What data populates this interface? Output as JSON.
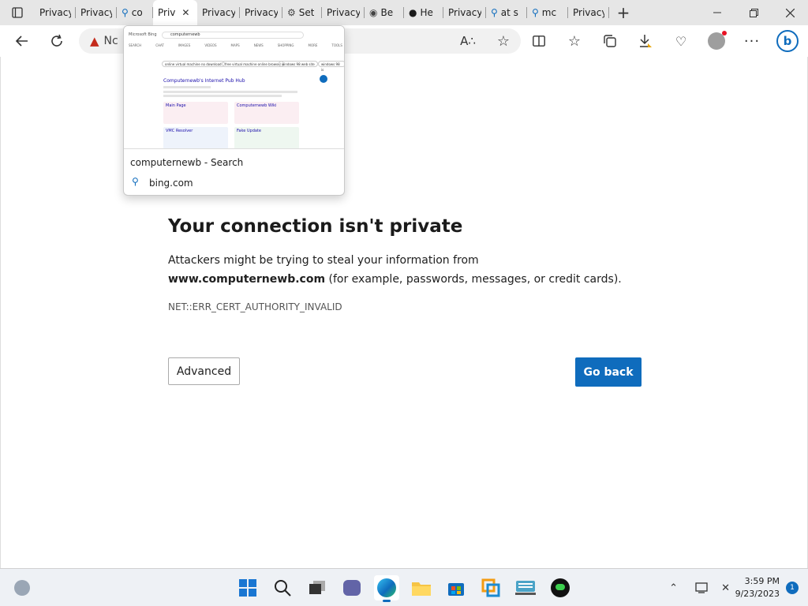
{
  "tabs": [
    {
      "label": "Privacy e",
      "icon": "doc-icon",
      "active": false
    },
    {
      "label": "Privacy e",
      "icon": "doc-icon",
      "active": false
    },
    {
      "label": "co",
      "icon": "search-icon",
      "active": false
    },
    {
      "label": "Priv",
      "icon": "doc-icon",
      "active": true
    },
    {
      "label": "Privacy e",
      "icon": "doc-icon",
      "active": false
    },
    {
      "label": "Privacy e",
      "icon": "doc-icon",
      "active": false
    },
    {
      "label": "Set",
      "icon": "gear-icon",
      "active": false
    },
    {
      "label": "Privacy e",
      "icon": "doc-icon",
      "active": false
    },
    {
      "label": "Be",
      "icon": "chrome-icon",
      "active": false
    },
    {
      "label": "He",
      "icon": "opera-icon",
      "active": false
    },
    {
      "label": "Privacy e",
      "icon": "doc-icon",
      "active": false
    },
    {
      "label": "at s",
      "icon": "search-icon",
      "active": false
    },
    {
      "label": "mc",
      "icon": "search-icon",
      "active": false
    },
    {
      "label": "Privacy e",
      "icon": "doc-icon",
      "active": false
    }
  ],
  "address": {
    "prefix": "Nc"
  },
  "preview": {
    "title": "computernewb - Search",
    "domain": "bing.com",
    "thumb": {
      "logo": "Microsoft Bing",
      "query": "computernewb",
      "tabs": [
        "SEARCH",
        "CHAT",
        "IMAGES",
        "VIDEOS",
        "MAPS",
        "NEWS",
        "SHOPPING",
        "MORE",
        "TOOLS"
      ],
      "chips": [
        "online virtual machine no download",
        "free virtual machine online browser",
        "windows 98 web site",
        "windows 98 is"
      ],
      "result_title": "Computernewb's Internet Pub Hub",
      "cards": [
        {
          "title": "Main Page"
        },
        {
          "title": "Computernewb Wiki"
        },
        {
          "title": "VMC Resolver"
        },
        {
          "title": "Fake Update"
        }
      ]
    }
  },
  "error": {
    "title": "Your connection isn't private",
    "text_before": "Attackers might be trying to steal your information from ",
    "domain": "www.computernewb.com",
    "text_after": " (for example, passwords, messages, or credit cards).",
    "code": "NET::ERR_CERT_AUTHORITY_INVALID",
    "advanced_label": "Advanced",
    "back_label": "Go back"
  },
  "clock": {
    "time": "3:59 PM",
    "date": "9/23/2023"
  },
  "notifications": {
    "count": "1"
  },
  "colors": {
    "accent": "#0f6cbd",
    "warn": "#c42b1c"
  }
}
